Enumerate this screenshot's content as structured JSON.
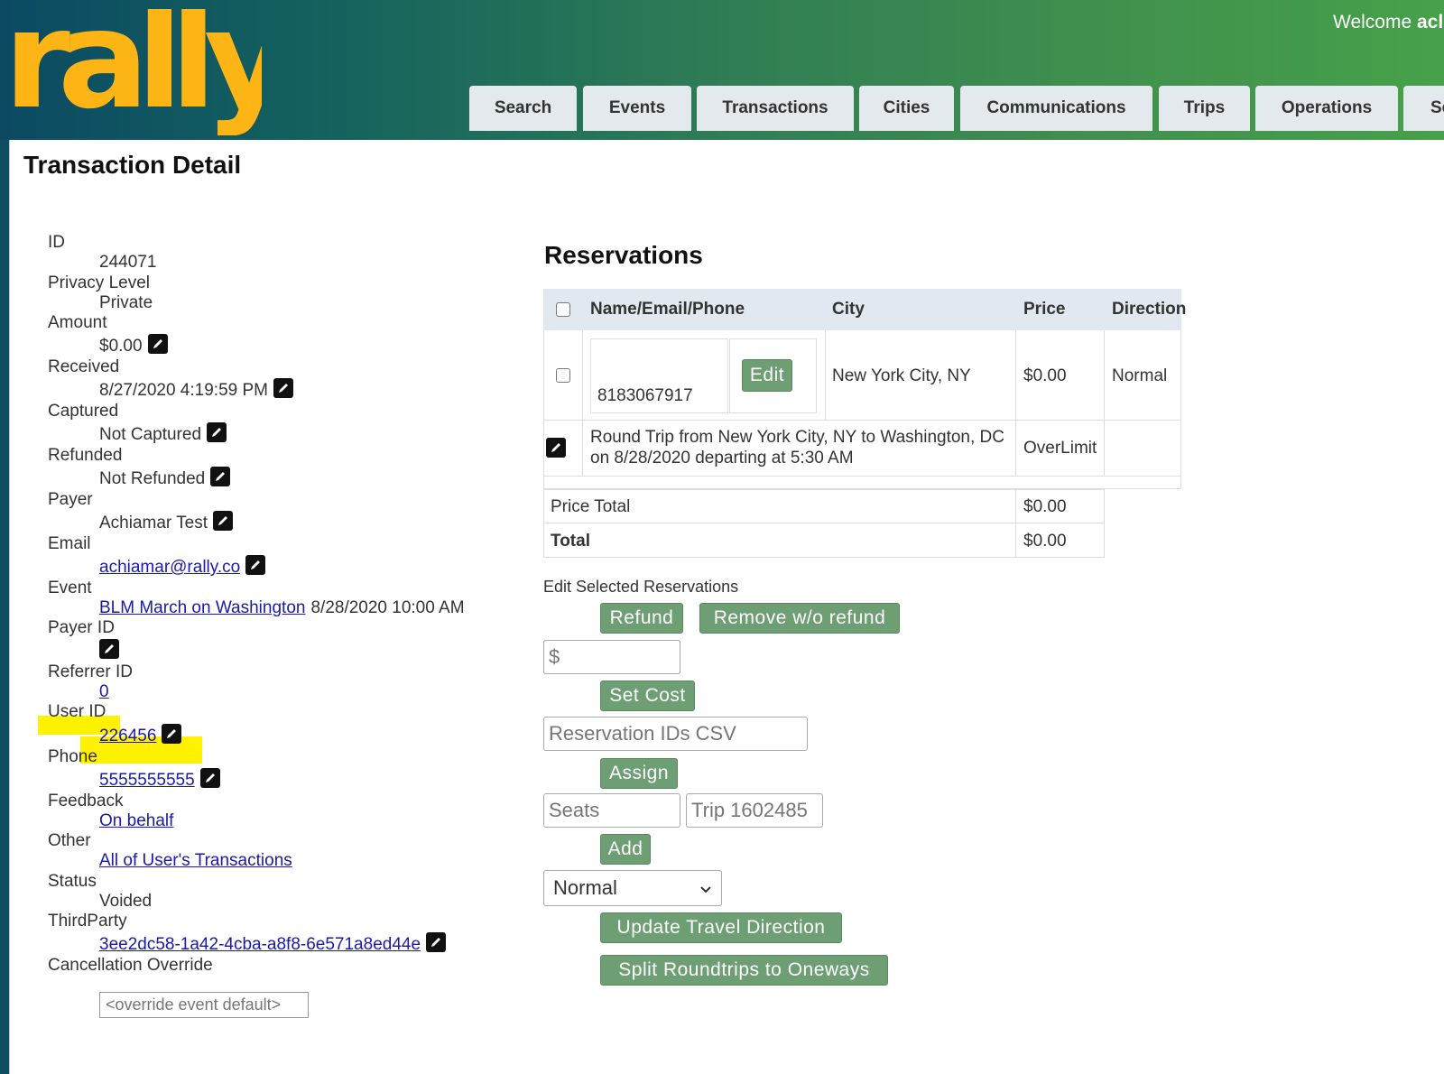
{
  "header": {
    "logo_text": "rally",
    "welcome_prefix": "Welcome ",
    "welcome_name": "acl",
    "tabs": [
      {
        "label": "Search"
      },
      {
        "label": "Events"
      },
      {
        "label": "Transactions"
      },
      {
        "label": "Cities"
      },
      {
        "label": "Communications"
      },
      {
        "label": "Trips"
      },
      {
        "label": "Operations"
      },
      {
        "label": "Se"
      }
    ]
  },
  "page": {
    "title": "Transaction Detail"
  },
  "details": {
    "id_label": "ID",
    "id_value": "244071",
    "privacy_label": "Privacy Level",
    "privacy_value": "Private",
    "amount_label": "Amount",
    "amount_value": "$0.00",
    "received_label": "Received",
    "received_value": "8/27/2020 4:19:59 PM",
    "captured_label": "Captured",
    "captured_value": "Not Captured",
    "refunded_label": "Refunded",
    "refunded_value": "Not Refunded",
    "payer_label": "Payer",
    "payer_value": "Achiamar Test",
    "email_label": "Email",
    "email_value": "achiamar@rally.co",
    "event_label": "Event",
    "event_link": "BLM March on Washington",
    "event_date": "8/28/2020 10:00 AM",
    "payer_id_label": "Payer ID",
    "referrer_label": "Referrer ID",
    "referrer_value": "0",
    "user_id_label": "User ID",
    "user_id_value": "226456",
    "phone_label": "Phone",
    "phone_value": "5555555555",
    "feedback_label": "Feedback",
    "feedback_value": "On behalf",
    "other_label": "Other",
    "other_value": "All of User's Transactions",
    "status_label": "Status",
    "status_value": "Voided",
    "thirdparty_label": "ThirdParty",
    "thirdparty_value": "3ee2dc58-1a42-4cba-a8f8-6e571a8ed44e",
    "cancellation_label": "Cancellation Override",
    "cancellation_placeholder": "<override event default>"
  },
  "reservations": {
    "title": "Reservations",
    "columns": [
      "Name/Email/Phone",
      "City",
      "Price",
      "Direction"
    ],
    "row": {
      "phone": "8183067917",
      "edit_label": "Edit",
      "city": "New York City, NY",
      "price": "$0.00",
      "direction": "Normal"
    },
    "trip": {
      "line1": "Round Trip from New York City, NY to Washington, DC",
      "line2": "on 8/28/2020 departing at 5:30 AM",
      "status": "OverLimit"
    },
    "price_total_label": "Price Total",
    "price_total_value": "$0.00",
    "total_label": "Total",
    "total_value": "$0.00"
  },
  "edit_section": {
    "heading": "Edit Selected Reservations",
    "refund_label": "Refund",
    "remove_label": "Remove w/o refund",
    "cost_placeholder": "$",
    "set_cost_label": "Set Cost",
    "ids_placeholder": "Reservation IDs CSV",
    "assign_label": "Assign",
    "seats_placeholder": "Seats",
    "trip_placeholder": "Trip 1602485",
    "add_label": "Add",
    "direction_selected": "Normal",
    "update_direction_label": "Update Travel Direction",
    "split_label": "Split Roundtrips to Oneways"
  },
  "colors": {
    "logo": "#fdb515",
    "button_green": "#6e9f74",
    "highlight": "#fff200",
    "link": "#1a1aa6"
  }
}
